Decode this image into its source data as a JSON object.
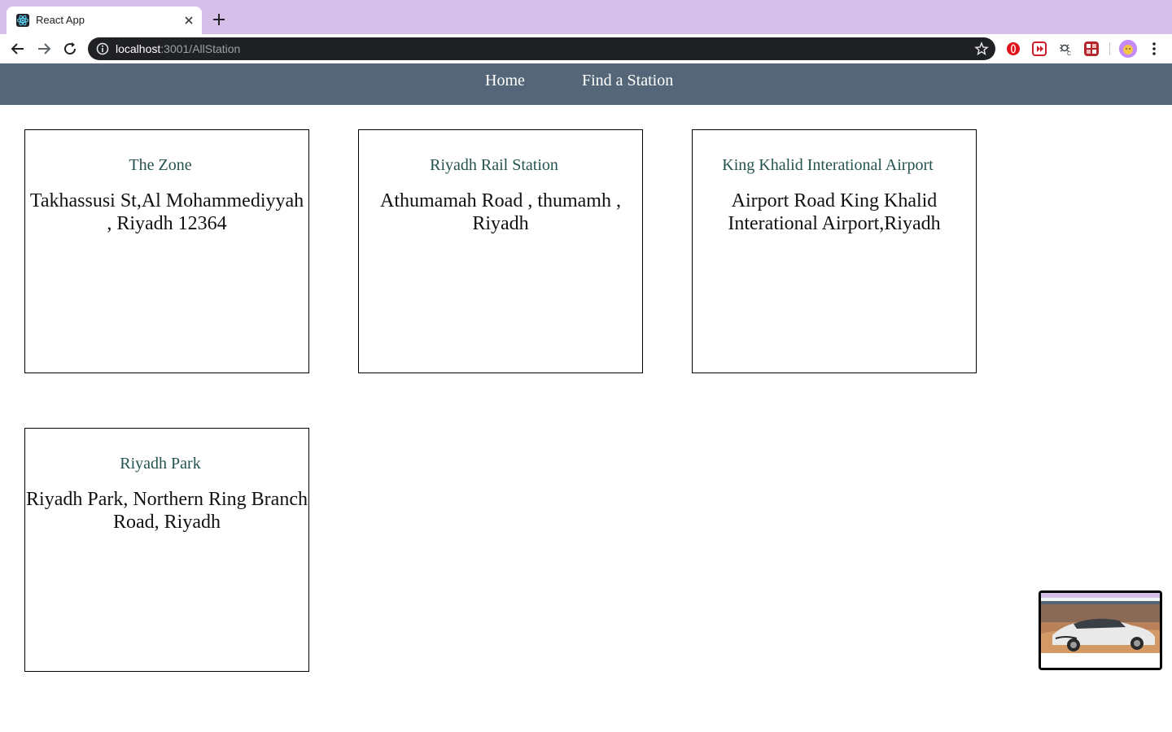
{
  "browser": {
    "tab_title": "React App",
    "url_host": "localhost",
    "url_path": ":3001/AllStation"
  },
  "nav": {
    "home_label": "Home",
    "find_label": "Find a Station"
  },
  "stations": [
    {
      "name": "The Zone",
      "address": "Takhassusi St,Al Mohammediyyah , Riyadh 12364"
    },
    {
      "name": "Riyadh Rail Station",
      "address": "Athumamah Road , thumamh , Riyadh"
    },
    {
      "name": "King Khalid Interational Airport",
      "address": "Airport Road King Khalid Interational Airport,Riyadh"
    },
    {
      "name": "Riyadh Park",
      "address": "Riyadh Park, Northern Ring Branch Road, Riyadh"
    }
  ],
  "colors": {
    "tabbar": "#d6c0ea",
    "nav_bg": "#546677",
    "card_title": "#24524f"
  },
  "icons": {
    "favicon": "react-icon",
    "back": "back-arrow-icon",
    "forward": "forward-arrow-icon",
    "reload": "reload-icon",
    "info": "info-icon",
    "star": "bookmark-star-icon"
  }
}
